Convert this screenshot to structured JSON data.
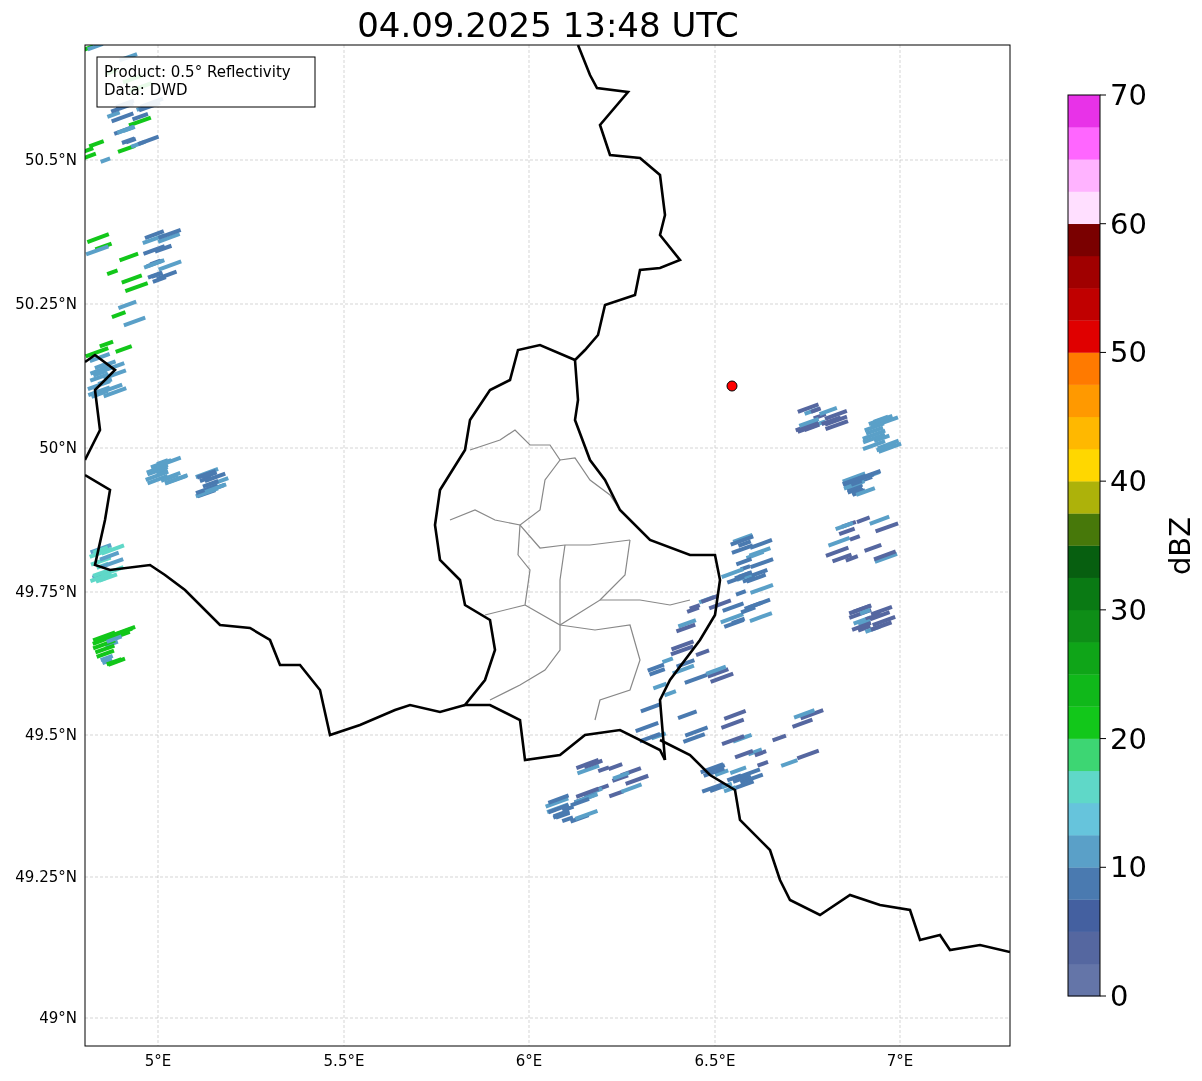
{
  "title": "04.09.2025 13:48 UTC",
  "info_box": [
    "Product: 0.5° Reflectivity",
    "Data: DWD"
  ],
  "latitude_ticks": [
    "50.5°N",
    "50.25°N",
    "50°N",
    "49.75°N",
    "49.5°N",
    "49.25°N",
    "49°N"
  ],
  "longitude_ticks": [
    "5°E",
    "5.5°E",
    "6°E",
    "6.5°E",
    "7°E"
  ],
  "colorbar": {
    "label": "dBZ",
    "ticks": [
      "70",
      "60",
      "50",
      "40",
      "30",
      "20",
      "10",
      "0"
    ],
    "bands": [
      {
        "color": "#6475a8"
      },
      {
        "color": "#5567a0"
      },
      {
        "color": "#4460a0"
      },
      {
        "color": "#4a7ab0"
      },
      {
        "color": "#5aa0c8"
      },
      {
        "color": "#66c4dc"
      },
      {
        "color": "#5fd8c8"
      },
      {
        "color": "#3dd673"
      },
      {
        "color": "#12c71a"
      },
      {
        "color": "#10b81a"
      },
      {
        "color": "#0fa518"
      },
      {
        "color": "#0e8e17"
      },
      {
        "color": "#0a7a14"
      },
      {
        "color": "#075f10"
      },
      {
        "color": "#47780a"
      },
      {
        "color": "#adb20a"
      },
      {
        "color": "#ffd700"
      },
      {
        "color": "#ffb800"
      },
      {
        "color": "#ff9900"
      },
      {
        "color": "#ff7a00"
      },
      {
        "color": "#e00000"
      },
      {
        "color": "#c00000"
      },
      {
        "color": "#a00000"
      },
      {
        "color": "#7a0000"
      },
      {
        "color": "#ffdfff"
      },
      {
        "color": "#ffb3ff"
      },
      {
        "color": "#ff66ff"
      },
      {
        "color": "#e832e8"
      }
    ]
  }
}
